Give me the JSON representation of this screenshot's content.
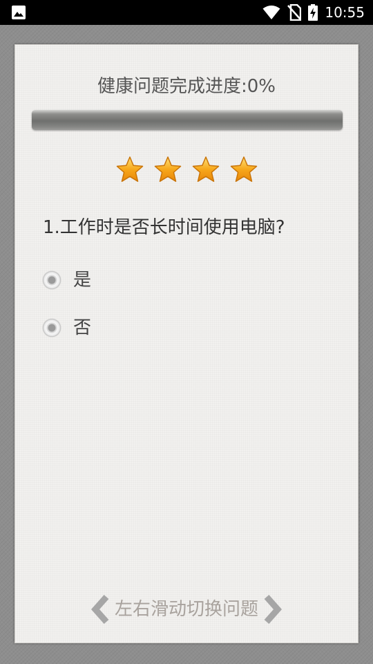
{
  "status_bar": {
    "time": "10:55",
    "icons": [
      "gallery-icon",
      "wifi-icon",
      "no-sim-icon",
      "battery-charging-icon"
    ]
  },
  "progress": {
    "title": "健康问题完成进度:0%",
    "value": 0
  },
  "stars": {
    "count": 4,
    "color": "#f7a81b"
  },
  "question": {
    "text": "1.工作时是否长时间使用电脑?",
    "options": [
      {
        "label": "是"
      },
      {
        "label": "否"
      }
    ]
  },
  "footer": {
    "hint": "左右滑动切换问题",
    "icons": [
      "chevron-left-icon",
      "chevron-right-icon"
    ]
  }
}
